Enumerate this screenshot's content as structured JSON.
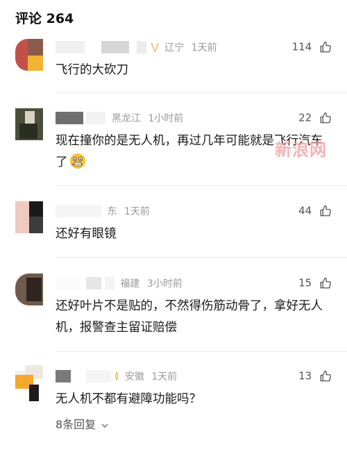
{
  "header": {
    "title": "评论 264"
  },
  "watermark": "新浪网",
  "comments": [
    {
      "location": "辽宁",
      "time": "1天前",
      "likes": "114",
      "text": "飞行的大砍刀"
    },
    {
      "location": "黑龙江",
      "time": "1小时前",
      "likes": "22",
      "text": "现在撞你的是无人机，再过几年可能就是飞行汽车了",
      "emoji": "grimace-emoji"
    },
    {
      "location": "东",
      "time": "1天前",
      "likes": "44",
      "text": "还好有眼镜"
    },
    {
      "location": "福建",
      "time": "3小时前",
      "likes": "15",
      "text": "还好叶片不是贴的，不然得伤筋动骨了，拿好无人机，报警查主留证赔偿"
    },
    {
      "location": "安徽",
      "time": "1天前",
      "likes": "13",
      "text": "无人机不都有避障功能吗？",
      "replies": "8条回复"
    }
  ],
  "icons": {
    "like": "thumbs-up-icon",
    "expand": "chevron-down-icon",
    "badge": "v-badge-icon"
  },
  "colors": {
    "meta": "#9a9a9a",
    "watermark": "#f39a9a",
    "badge": "#e8b341"
  }
}
